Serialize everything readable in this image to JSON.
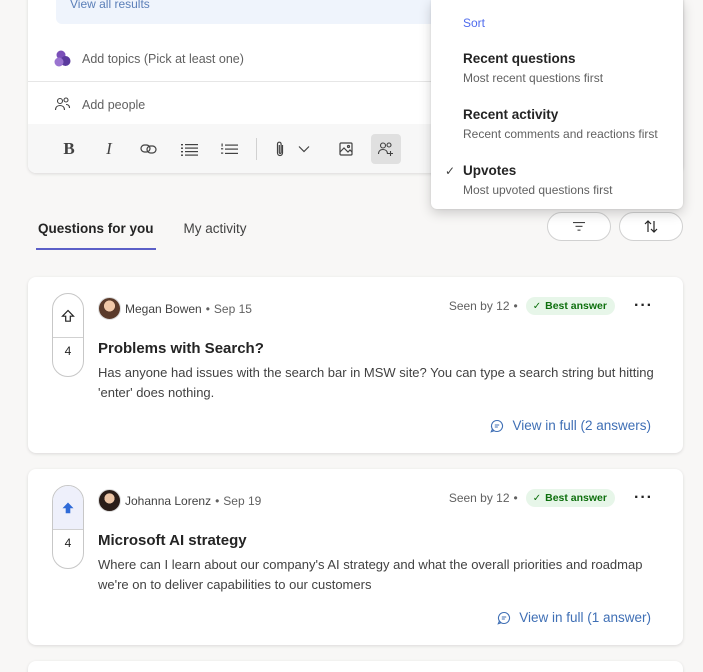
{
  "composer": {
    "view_all": "View all results",
    "topics_placeholder": "Add topics (Pick at least one)",
    "people_placeholder": "Add people"
  },
  "toolbar": {
    "bold": "B",
    "italic": "I"
  },
  "tabs": [
    {
      "label": "Questions for you",
      "selected": true
    },
    {
      "label": "My activity",
      "selected": false
    }
  ],
  "sort_menu": {
    "header": "Sort",
    "items": [
      {
        "title": "Recent questions",
        "desc": "Most recent questions first",
        "checked": false
      },
      {
        "title": "Recent activity",
        "desc": "Recent comments and reactions first",
        "checked": false
      },
      {
        "title": "Upvotes",
        "desc": "Most upvoted questions first",
        "checked": true
      }
    ],
    "check_glyph": "✓"
  },
  "questions": [
    {
      "author": "Megan Bowen",
      "date": "Sep 15",
      "seen": "Seen by 12",
      "badge": "Best answer",
      "votes": "4",
      "upvoted": false,
      "title": "Problems with Search?",
      "body": "Has anyone had issues with the search bar in MSW site? You can type a search string but hitting 'enter' does nothing.",
      "view_full": "View in full (2 answers)"
    },
    {
      "author": "Johanna Lorenz",
      "date": "Sep 19",
      "seen": "Seen by 12",
      "badge": "Best answer",
      "votes": "4",
      "upvoted": true,
      "title": "Microsoft AI strategy",
      "body": "Where can I learn about our company's AI strategy and what the overall priorities and roadmap we're on to deliver capabilities to our customers",
      "view_full": "View in full (1 answer)"
    }
  ],
  "colors": {
    "accent": "#5b5fc7",
    "link": "#3f6fb5",
    "upvote_active": "#2f6bd8",
    "badge_bg": "#e7f6e9",
    "badge_text": "#0e700e"
  }
}
